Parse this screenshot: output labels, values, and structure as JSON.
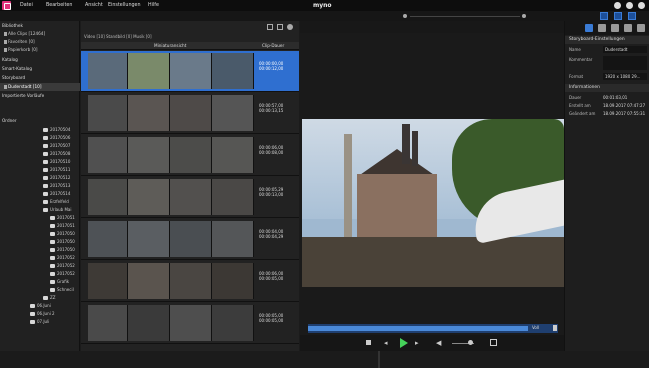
{
  "menubar": {
    "items": [
      "Datei",
      "Bearbeiten",
      "Ansicht",
      "Einstellungen",
      "Hilfe"
    ],
    "app_title": "myno"
  },
  "library": {
    "header": "Bibliothek",
    "items": [
      {
        "label": "Alle Clips [12464]",
        "icon": "clips-icon"
      },
      {
        "label": "Favoriten [0]",
        "icon": "star-icon"
      },
      {
        "label": "Papierkorb [0]",
        "icon": "trash-icon"
      }
    ],
    "katalog": "Katalog",
    "smart_katalog": "Smart-Katalog",
    "storyboard": "Storyboard",
    "storyboard_item": "Duderstadt [10]",
    "exports": "Importierte Vorläufe",
    "ordner": "Ordner"
  },
  "folders": [
    "20170504",
    "20170506",
    "20170507",
    "20170508",
    "20170510",
    "20170511",
    "20170512",
    "20170513",
    "20170514",
    "Erzfelfeld",
    "Urlaub Mai",
    "2017051",
    "2017051",
    "2017050",
    "2017050",
    "2017050",
    "2017052",
    "2017052",
    "2017052",
    "Grafik",
    "Schnecil",
    "ZZ",
    "06.Juni",
    "06.Juni 2",
    "07.Juli"
  ],
  "filmstrip": {
    "tabs": "Video [10]  Standbild [0]  Musik [0]",
    "col_thumbs": "Miniaturansicht",
    "col_duration": "Clip-Dauer",
    "strips": [
      {
        "t1": "00:00:00,00",
        "t2": "00:00:12,00",
        "selected": true
      },
      {
        "t1": "00:00:57,00",
        "t2": "00:00:13,15",
        "selected": false
      },
      {
        "t1": "00:00:06,00",
        "t2": "00:00:08,00",
        "selected": false
      },
      {
        "t1": "00:00:05,29",
        "t2": "00:00:13,00",
        "selected": false
      },
      {
        "t1": "00:00:04,00",
        "t2": "00:00:04,29",
        "selected": false
      },
      {
        "t1": "00:00:06,00",
        "t2": "00:00:05,00",
        "selected": false
      },
      {
        "t1": "00:00:05,00",
        "t2": "00:00:05,00",
        "selected": false
      }
    ]
  },
  "viewer": {
    "timeline_label": "Voll",
    "progress": 0.88
  },
  "properties": {
    "section1": "Storyboard-Einstellungen",
    "name_label": "Name",
    "name_value": "Duderstadt",
    "kommentar_label": "Kommentar",
    "kommentar_value": "",
    "format_label": "Format",
    "format_value": "1920 x 1080 29...",
    "section2": "Informationen",
    "dauer_label": "Dauer",
    "dauer_value": "00:01:03,01",
    "erstellt_label": "Erstellt am",
    "erstellt_value": "18.09.2017 07:47:27",
    "geaendert_label": "Geändert am",
    "geaendert_value": "18.09.2017 07:55:31"
  },
  "colors": {
    "accent": "#3a7bd5",
    "logo": "#e0317a",
    "play": "#45d25a"
  }
}
